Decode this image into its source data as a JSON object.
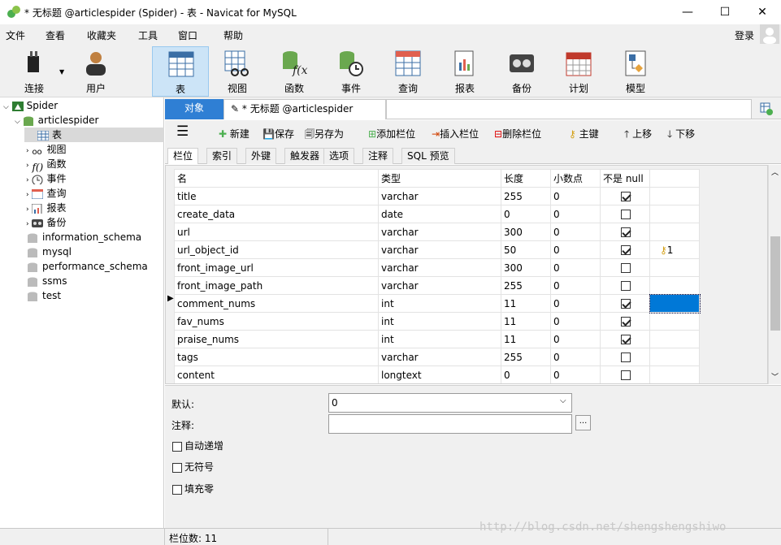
{
  "window": {
    "title": "* 无标题 @articlespider (Spider) - 表 - Navicat for MySQL",
    "minimize": "—",
    "maximize": "☐",
    "close": "✕"
  },
  "menubar": {
    "items": [
      "文件",
      "查看",
      "收藏夹",
      "工具",
      "窗口",
      "帮助"
    ],
    "login": "登录"
  },
  "toolbar": {
    "items": [
      {
        "label": "连接",
        "icon": "plug-icon"
      },
      {
        "label": "用户",
        "icon": "user-icon"
      },
      {
        "label": "表",
        "icon": "table-icon"
      },
      {
        "label": "视图",
        "icon": "view-icon"
      },
      {
        "label": "函数",
        "icon": "function-icon"
      },
      {
        "label": "事件",
        "icon": "event-icon"
      },
      {
        "label": "查询",
        "icon": "query-icon"
      },
      {
        "label": "报表",
        "icon": "report-icon"
      },
      {
        "label": "备份",
        "icon": "backup-icon"
      },
      {
        "label": "计划",
        "icon": "schedule-icon"
      },
      {
        "label": "模型",
        "icon": "model-icon"
      }
    ],
    "active": "表"
  },
  "tree": {
    "connection": "Spider",
    "database": "articlespider",
    "children": [
      "表",
      "视图",
      "函数",
      "事件",
      "查询",
      "报表",
      "备份"
    ],
    "other_dbs": [
      "information_schema",
      "mysql",
      "performance_schema",
      "ssms",
      "test"
    ]
  },
  "tabs": {
    "objects": "对象",
    "editor": "* 无标题 @articlespider (Spi..."
  },
  "edit_toolbar": {
    "menu": "☰",
    "new": "新建",
    "save": "保存",
    "save_as": "另存为",
    "add_field": "添加栏位",
    "insert_field": "插入栏位",
    "delete_field": "删除栏位",
    "primary_key": "主键",
    "move_up": "上移",
    "move_down": "下移"
  },
  "subtabs": [
    "栏位",
    "索引",
    "外键",
    "触发器",
    "选项",
    "注释",
    "SQL 预览"
  ],
  "grid": {
    "headers": [
      "名",
      "类型",
      "长度",
      "小数点",
      "不是 null",
      ""
    ],
    "rows": [
      {
        "name": "title",
        "type": "varchar",
        "length": "255",
        "decimals": "0",
        "notnull": true,
        "key": ""
      },
      {
        "name": "create_data",
        "type": "date",
        "length": "0",
        "decimals": "0",
        "notnull": false,
        "key": ""
      },
      {
        "name": "url",
        "type": "varchar",
        "length": "300",
        "decimals": "0",
        "notnull": true,
        "key": ""
      },
      {
        "name": "url_object_id",
        "type": "varchar",
        "length": "50",
        "decimals": "0",
        "notnull": true,
        "key": "1"
      },
      {
        "name": "front_image_url",
        "type": "varchar",
        "length": "300",
        "decimals": "0",
        "notnull": false,
        "key": ""
      },
      {
        "name": "front_image_path",
        "type": "varchar",
        "length": "255",
        "decimals": "0",
        "notnull": false,
        "key": ""
      },
      {
        "name": "comment_nums",
        "type": "int",
        "length": "11",
        "decimals": "0",
        "notnull": true,
        "key": ""
      },
      {
        "name": "fav_nums",
        "type": "int",
        "length": "11",
        "decimals": "0",
        "notnull": true,
        "key": ""
      },
      {
        "name": "praise_nums",
        "type": "int",
        "length": "11",
        "decimals": "0",
        "notnull": true,
        "key": ""
      },
      {
        "name": "tags",
        "type": "varchar",
        "length": "255",
        "decimals": "0",
        "notnull": false,
        "key": ""
      },
      {
        "name": "content",
        "type": "longtext",
        "length": "0",
        "decimals": "0",
        "notnull": false,
        "key": ""
      }
    ],
    "current_row": 6
  },
  "props": {
    "default_label": "默认:",
    "default_value": "0",
    "comment_label": "注释:",
    "comment_btn": "...",
    "auto_increment": "自动递增",
    "unsigned": "无符号",
    "zerofill": "填充零"
  },
  "status": {
    "field_count": "栏位数: 11"
  },
  "watermark": "http://blog.csdn.net/shengshengshiwo",
  "colors": {
    "accent": "#0078d7",
    "selected_tab": "#cce4f7"
  }
}
